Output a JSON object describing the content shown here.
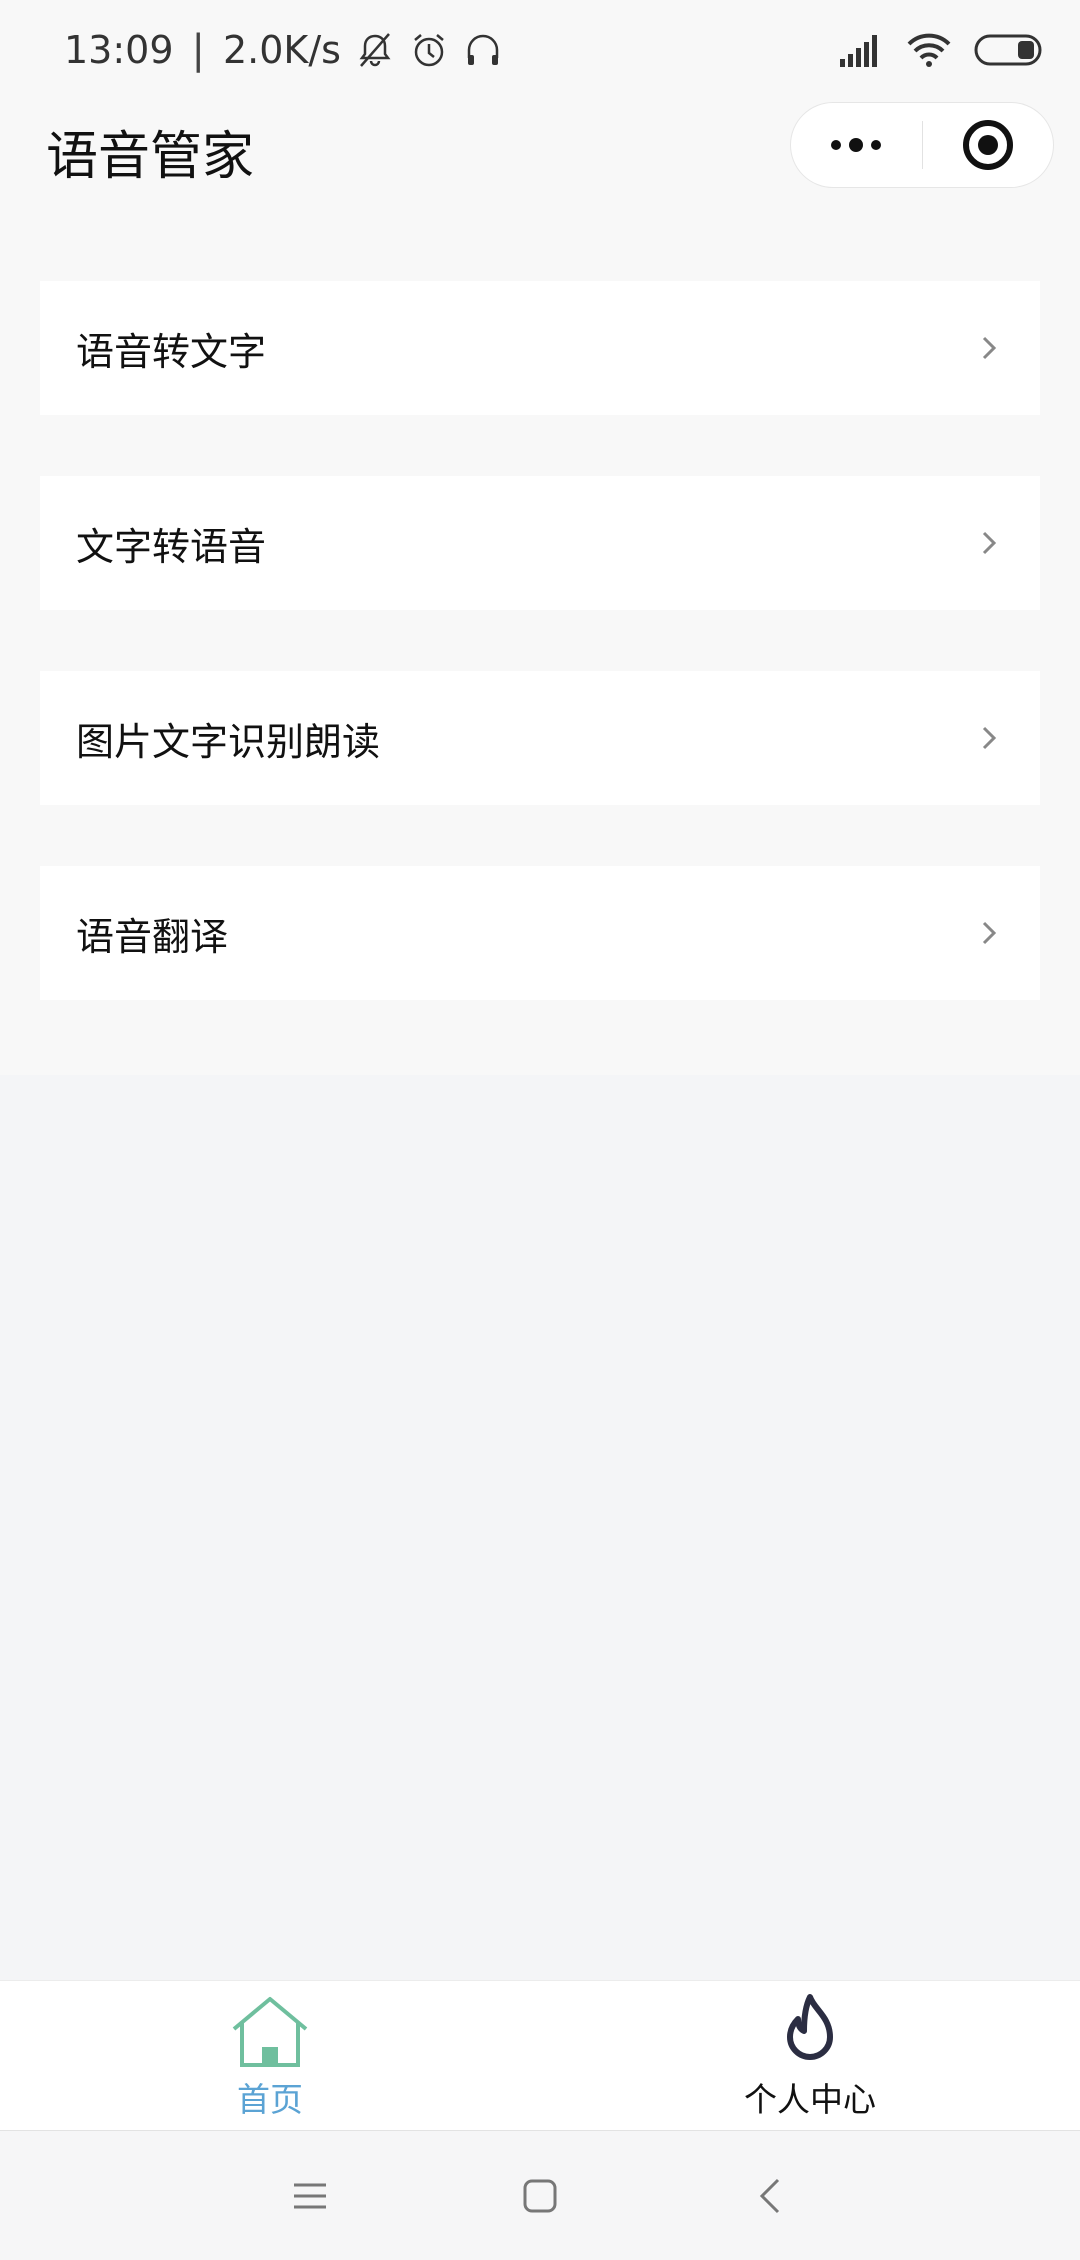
{
  "status_bar": {
    "time": "13:09",
    "separator": "|",
    "network_speed": "2.0K/s",
    "icons": [
      "bell-off-icon",
      "alarm-icon",
      "headphones-icon",
      "signal-icon",
      "wifi-icon",
      "battery-icon"
    ]
  },
  "header": {
    "title": "语音管家",
    "capsule": {
      "more_icon": "more-dots-icon",
      "close_icon": "target-close-icon"
    }
  },
  "menu": {
    "items": [
      {
        "label": "语音转文字"
      },
      {
        "label": "文字转语音"
      },
      {
        "label": "图片文字识别朗读"
      },
      {
        "label": "语音翻译"
      }
    ]
  },
  "tab_bar": {
    "tabs": [
      {
        "label": "首页",
        "icon": "home-icon",
        "active": true
      },
      {
        "label": "个人中心",
        "icon": "flame-icon",
        "active": false
      }
    ]
  },
  "nav_bar": {
    "icons": [
      "menu-lines-icon",
      "home-square-icon",
      "back-chevron-icon"
    ]
  },
  "colors": {
    "accent": "#5ba3d4",
    "home_icon": "#6fbf9e",
    "flame_icon": "#2b2d42",
    "background": "#f4f5f7"
  }
}
